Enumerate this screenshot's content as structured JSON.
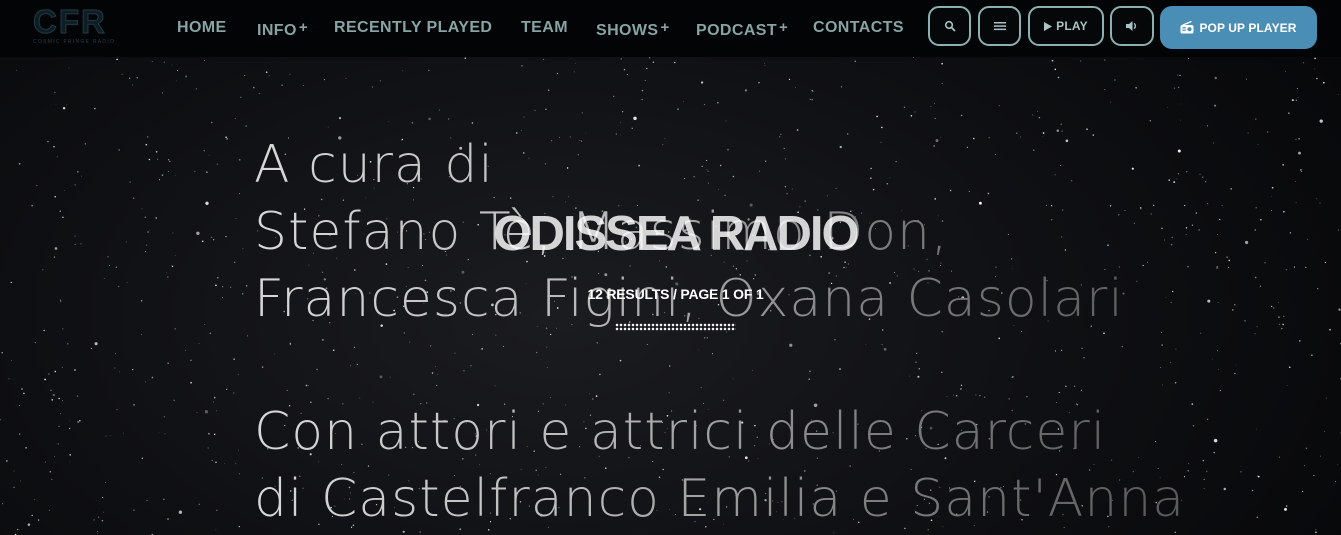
{
  "header": {
    "logo": {
      "mark": "CFR",
      "subtitle": "COSMIC FRINGE RADIO"
    },
    "nav": [
      {
        "label": "HOME",
        "has_submenu": false
      },
      {
        "label": "INFO",
        "has_submenu": true
      },
      {
        "label": "RECENTLY PLAYED",
        "has_submenu": false
      },
      {
        "label": "TEAM",
        "has_submenu": false
      },
      {
        "label": "SHOWS",
        "has_submenu": true
      },
      {
        "label": "PODCAST",
        "has_submenu": true
      },
      {
        "label": "CONTACTS",
        "has_submenu": false
      }
    ],
    "submenu_marker": "+",
    "controls": {
      "search_icon": "search-icon",
      "menu_icon": "hamburger-menu-icon",
      "play_label": "PLAY",
      "play_icon": "play-triangle-icon",
      "volume_icon": "speaker-volume-icon",
      "popup_label": "POP UP PLAYER",
      "popup_icon": "radio-icon"
    }
  },
  "hero": {
    "artwork_text": {
      "lines": [
        "A cura di",
        "Stefano Tè, Massimo Don,",
        "Francesca Figini, Oxana Casolari",
        "Con attori e attrici delle Carceri",
        "di Castelfranco Emilia e Sant'Anna"
      ]
    },
    "title": "ODISSEA RADIO",
    "results": "12 RESULTS / PAGE 1 OF 1"
  },
  "colors": {
    "nav_text": "#86a3a6",
    "control_border": "#8ab0b2",
    "popup_button": "#4a8db5",
    "header_bg": "#030405",
    "hero_bg": "#0f1013"
  }
}
